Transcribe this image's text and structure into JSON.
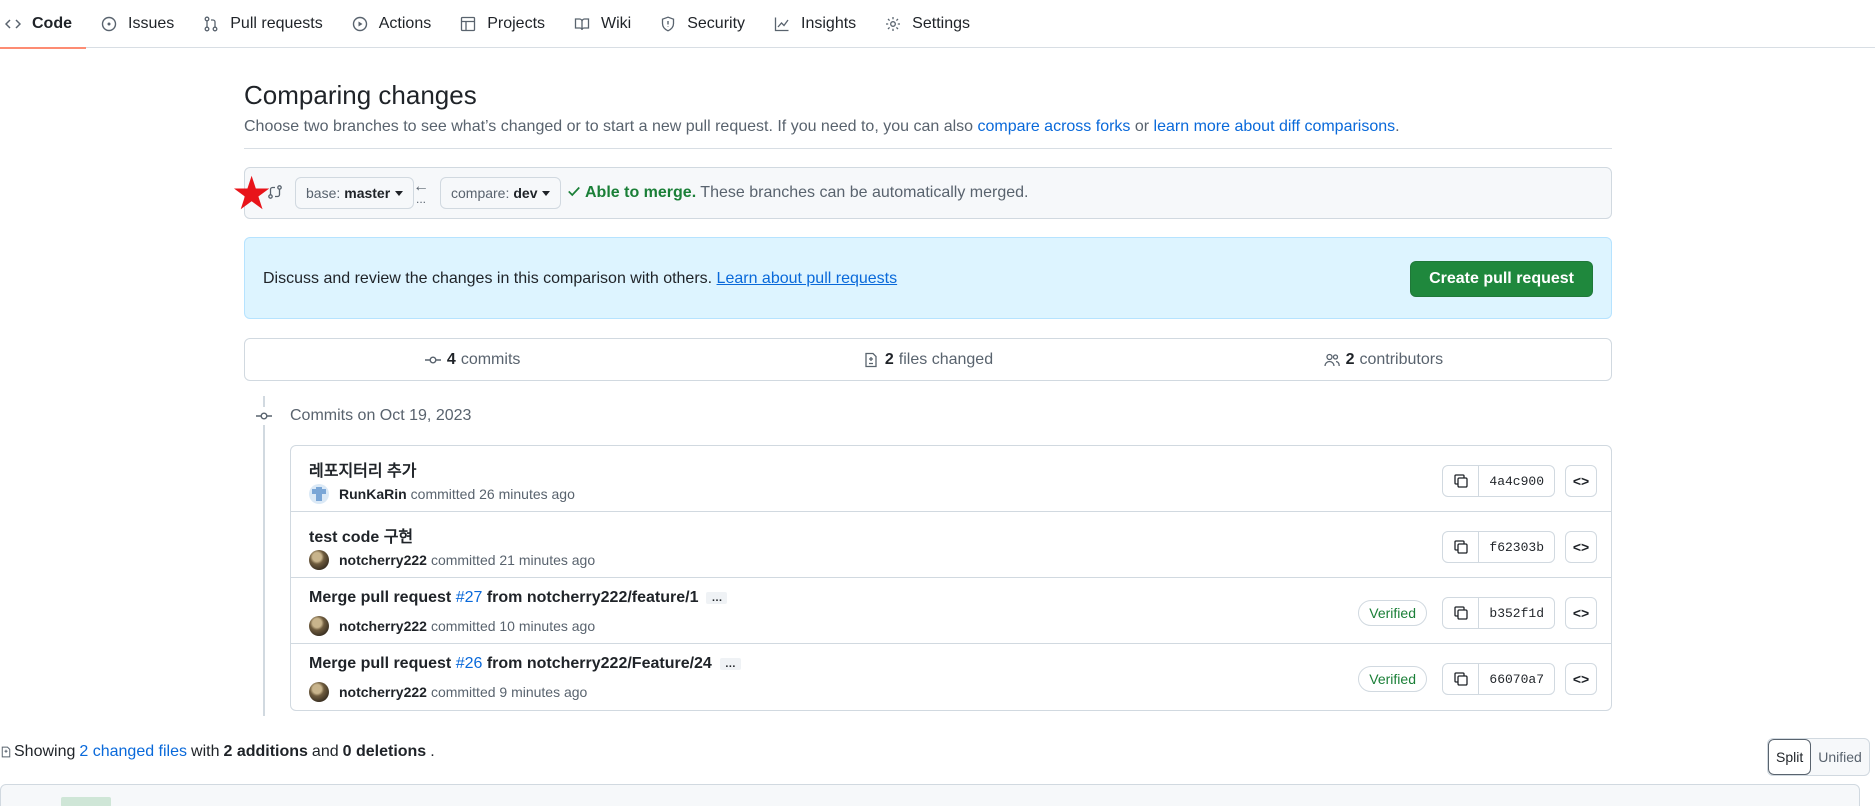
{
  "nav": {
    "tabs": [
      {
        "label": "Code",
        "icon": "code-icon",
        "active": true
      },
      {
        "label": "Issues",
        "icon": "issue-opened-icon"
      },
      {
        "label": "Pull requests",
        "icon": "git-pull-request-icon"
      },
      {
        "label": "Actions",
        "icon": "play-icon"
      },
      {
        "label": "Projects",
        "icon": "table-icon"
      },
      {
        "label": "Wiki",
        "icon": "book-icon"
      },
      {
        "label": "Security",
        "icon": "shield-icon"
      },
      {
        "label": "Insights",
        "icon": "graph-icon"
      },
      {
        "label": "Settings",
        "icon": "gear-icon"
      }
    ]
  },
  "header": {
    "title": "Comparing changes",
    "desc_prefix": "Choose two branches to see what’s changed or to start a new pull request. If you need to, you can also ",
    "link_forks": "compare across forks",
    "desc_or": " or ",
    "link_learn": "learn more about diff comparisons",
    "desc_suffix": "."
  },
  "range": {
    "base_label": "base:",
    "base_value": "master",
    "compare_label": "compare:",
    "compare_value": "dev",
    "arrow": "←",
    "dots": "...",
    "merge_ok": "Able to merge.",
    "merge_msg": " These branches can be automatically merged."
  },
  "discuss": {
    "text": "Discuss and review the changes in this comparison with others. ",
    "link": "Learn about pull requests",
    "button": "Create pull request"
  },
  "overview": {
    "commits_count": "4",
    "commits_label": "commits",
    "files_count": "2",
    "files_label": "files changed",
    "contributors_count": "2",
    "contributors_label": "contributors"
  },
  "timeline": {
    "heading": "Commits on Oct 19, 2023",
    "commits": [
      {
        "title": "레포지터리 추가",
        "author": "RunKaRin",
        "time": "committed 26 minutes ago",
        "sha": "4a4c900"
      },
      {
        "title": "test code 구현",
        "author": "notcherry222",
        "time": "committed 21 minutes ago",
        "sha": "f62303b"
      },
      {
        "title_prefix": "Merge pull request ",
        "pr": "#27",
        "title_suffix": " from notcherry222/feature/1",
        "ellipsis": "…",
        "verified": "Verified",
        "author": "notcherry222",
        "time": "committed 10 minutes ago",
        "sha": "b352f1d"
      },
      {
        "title_prefix": "Merge pull request ",
        "pr": "#26",
        "title_suffix": " from notcherry222/Feature/24",
        "ellipsis": "…",
        "verified": "Verified",
        "author": "notcherry222",
        "time": "committed 9 minutes ago",
        "sha": "66070a7"
      }
    ]
  },
  "diffstat": {
    "showing": "Showing",
    "files_link": "2 changed files",
    "with": "with",
    "additions": "2 additions",
    "and": "and",
    "deletions": "0 deletions",
    "end": "."
  },
  "view_toggle": {
    "split": "Split",
    "unified": "Unified"
  },
  "colors": {
    "accent_link": "#0969da",
    "success": "#1a7f37",
    "primary_button": "#1f883d",
    "discuss_bg": "#ddf4ff",
    "star": "#e8141a"
  }
}
